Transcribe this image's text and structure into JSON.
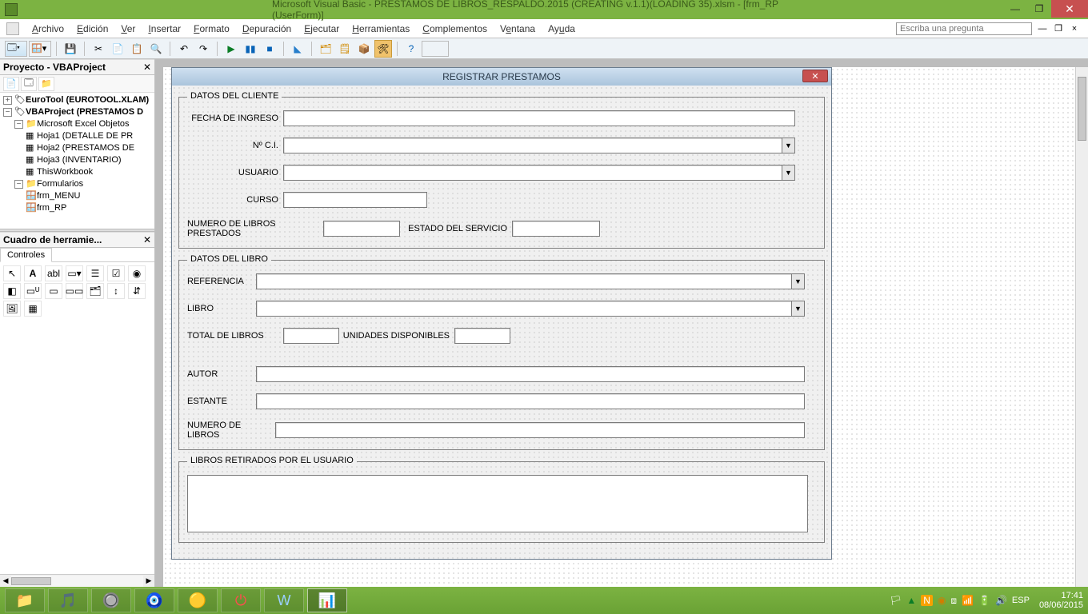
{
  "window": {
    "title": "Microsoft Visual Basic - PRESTAMOS DE LIBROS_RESPALDO.2015 (CREATING v.1.1)(LOADING 35).xlsm - [frm_RP (UserForm)]"
  },
  "menu": {
    "items": [
      "Archivo",
      "Edición",
      "Ver",
      "Insertar",
      "Formato",
      "Depuración",
      "Ejecutar",
      "Herramientas",
      "Complementos",
      "Ventana",
      "Ayuda"
    ],
    "askbox": "Escriba una pregunta"
  },
  "project": {
    "title": "Proyecto - VBAProject",
    "nodes": {
      "eurotool": "EuroTool (EUROTOOL.XLAM)",
      "vbaproject": "VBAProject (PRESTAMOS D",
      "excel_objects": "Microsoft Excel Objetos",
      "hoja1": "Hoja1 (DETALLE DE PR",
      "hoja2": "Hoja2 (PRESTAMOS DE",
      "hoja3": "Hoja3 (INVENTARIO)",
      "thiswb": "ThisWorkbook",
      "forms": "Formularios",
      "frm_menu": "frm_MENU",
      "frm_rp": "frm_RP"
    }
  },
  "toolbox": {
    "title": "Cuadro de herramie...",
    "tab": "Controles"
  },
  "userform": {
    "title": "REGISTRAR PRESTAMOS",
    "frame1": {
      "legend": "DATOS DEL CLIENTE",
      "fecha": "FECHA DE INGRESO",
      "nci": "Nº C.I.",
      "usuario": "USUARIO",
      "curso": "CURSO",
      "numlibros": "NUMERO DE LIBROS PRESTADOS",
      "estado": "ESTADO DEL SERVICIO"
    },
    "frame2": {
      "legend": "DATOS DEL LIBRO",
      "referencia": "REFERENCIA",
      "libro": "LIBRO",
      "total": "TOTAL DE LIBROS",
      "unid": "UNIDADES DISPONIBLES",
      "autor": "AUTOR",
      "estante": "ESTANTE",
      "numero": "NUMERO DE LIBROS"
    },
    "frame3": {
      "legend": "LIBROS RETIRADOS POR EL USUARIO"
    }
  },
  "systray": {
    "lang": "ESP",
    "time": "17:41",
    "date": "08/06/2015"
  }
}
